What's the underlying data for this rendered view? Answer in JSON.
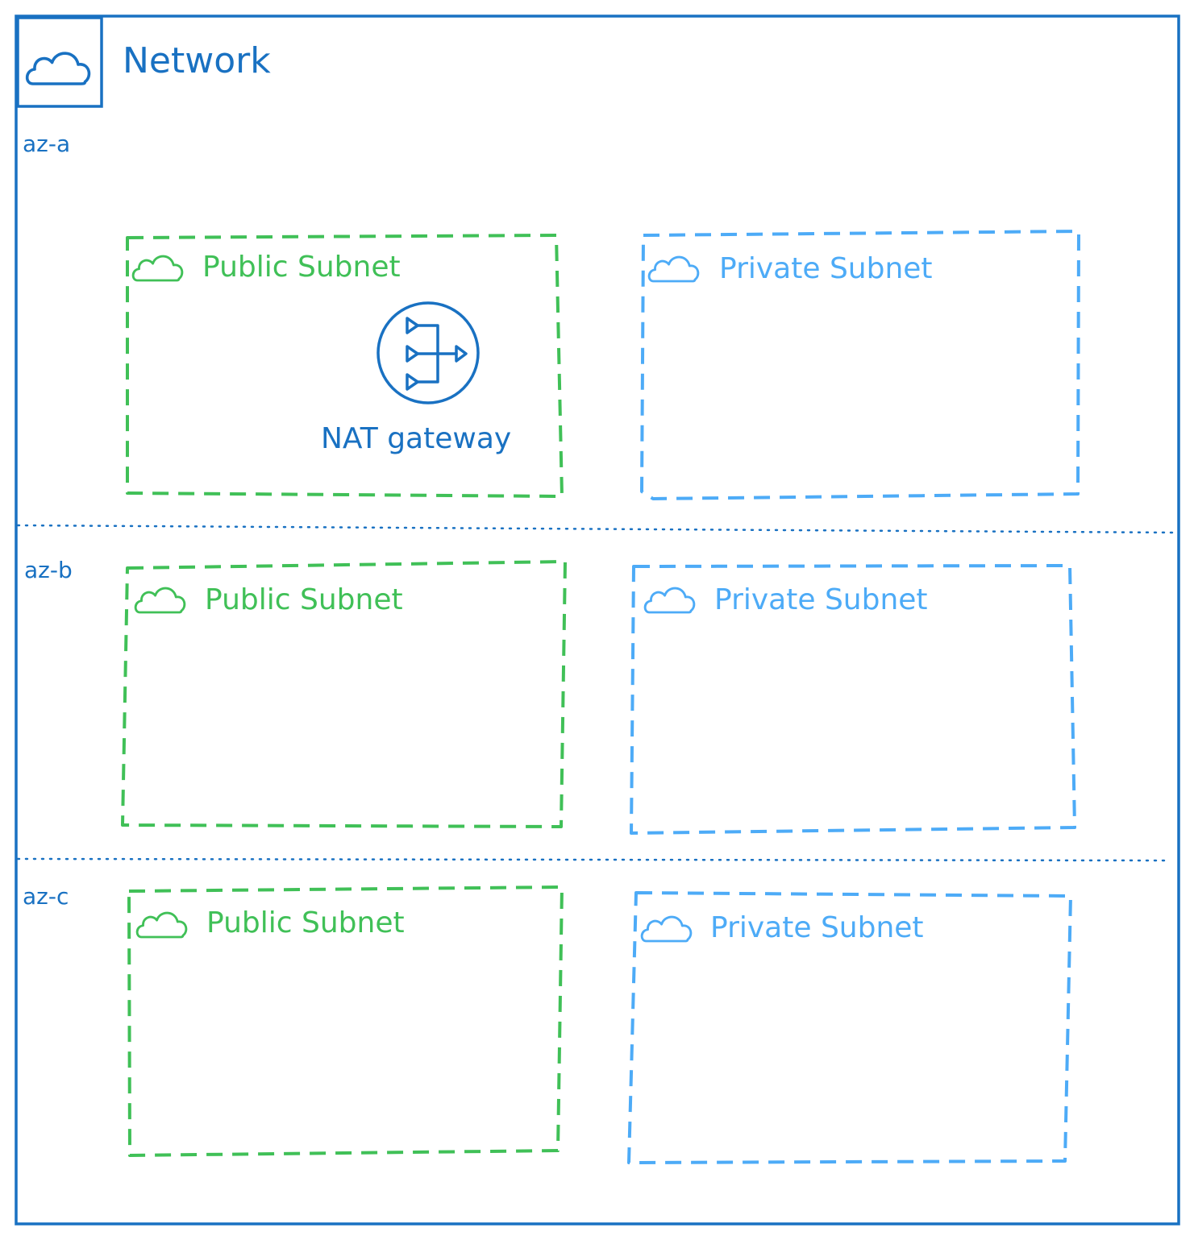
{
  "colors": {
    "network": "#1971c2",
    "public": "#40c057",
    "private": "#4dabf7",
    "nat": "#1971c2"
  },
  "network": {
    "title": "Network",
    "icon": "cloud-icon"
  },
  "zones": [
    {
      "label": "az-a",
      "public": {
        "label": "Public Subnet",
        "icon": "cloud-icon"
      },
      "private": {
        "label": "Private Subnet",
        "icon": "cloud-icon"
      },
      "nat": {
        "label": "NAT gateway",
        "icon": "nat-gateway-icon"
      }
    },
    {
      "label": "az-b",
      "public": {
        "label": "Public Subnet",
        "icon": "cloud-icon"
      },
      "private": {
        "label": "Private Subnet",
        "icon": "cloud-icon"
      }
    },
    {
      "label": "az-c",
      "public": {
        "label": "Public Subnet",
        "icon": "cloud-icon"
      },
      "private": {
        "label": "Private Subnet",
        "icon": "cloud-icon"
      }
    }
  ]
}
